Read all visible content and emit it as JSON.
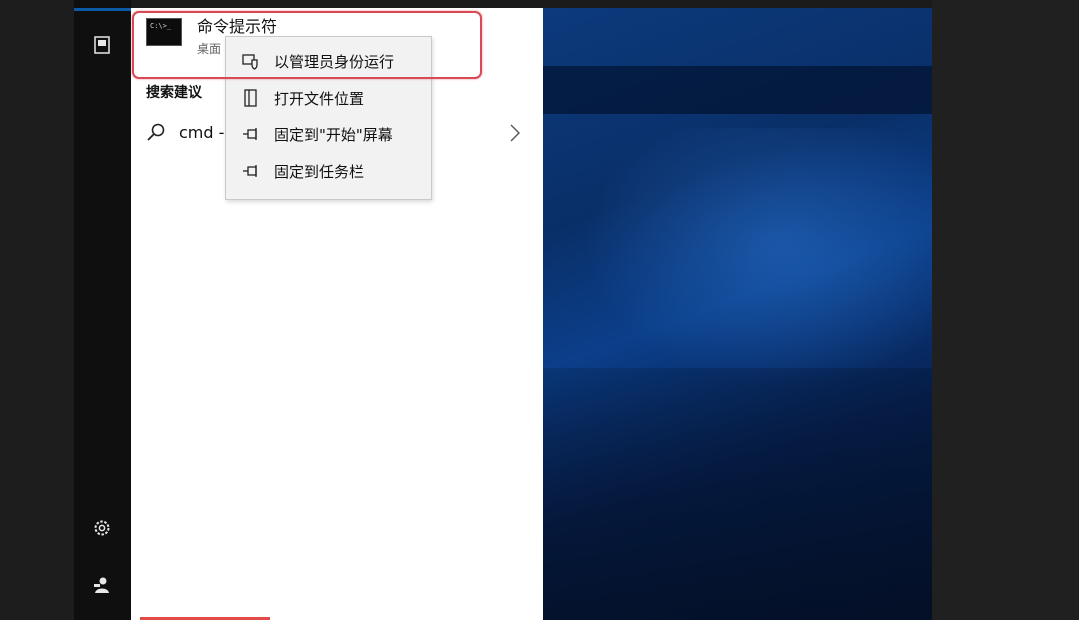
{
  "search_results": {
    "best_match_app": {
      "title": "命令提示符",
      "subtitle": "桌面",
      "tile_text": "C:\\>_"
    },
    "section_header": "搜索建议",
    "suggestion": {
      "text": "cmd -"
    }
  },
  "context_menu": {
    "items": [
      {
        "label": "以管理员身份运行",
        "icon": "shield-icon"
      },
      {
        "label": "打开文件位置",
        "icon": "folder-icon"
      },
      {
        "label": "固定到\"开始\"屏幕",
        "icon": "pin-icon"
      },
      {
        "label": "固定到任务栏",
        "icon": "pin-icon"
      }
    ]
  },
  "rail": {
    "icons": [
      "document-icon",
      "settings-icon",
      "user-icon"
    ]
  },
  "colors": {
    "highlight_frame": "#d84a55",
    "wallpaper": "#0b3f8a",
    "rail": "#0f0f0f"
  }
}
